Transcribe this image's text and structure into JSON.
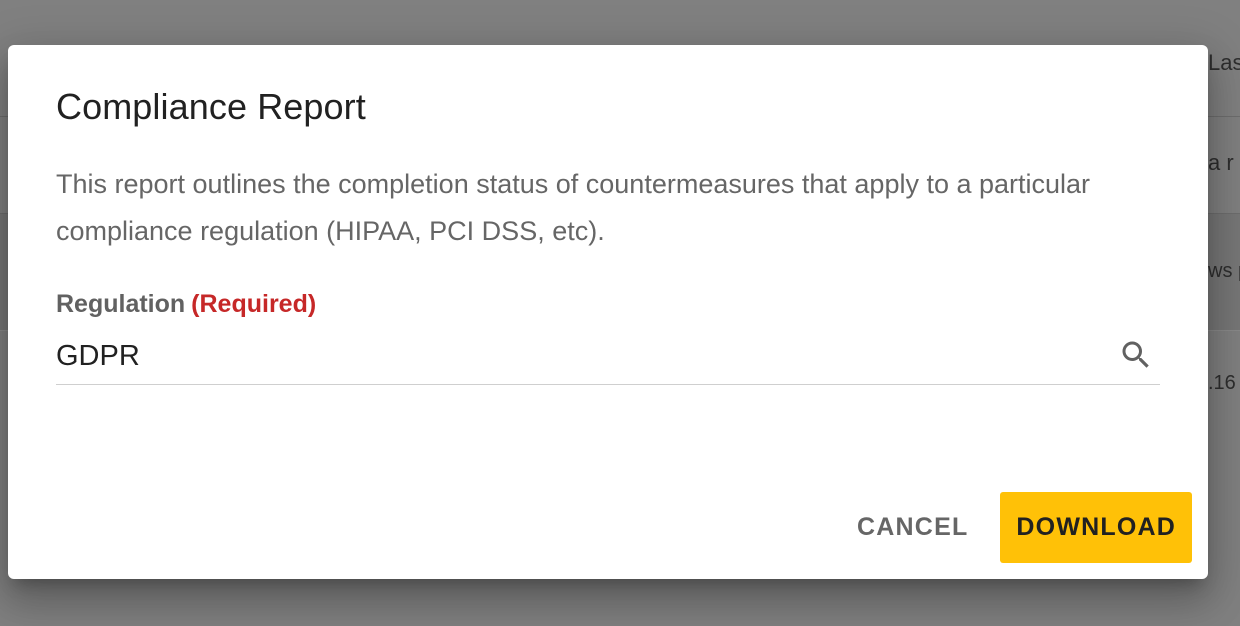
{
  "background": {
    "rows": [
      "Las",
      "a r",
      "ws p",
      ".16"
    ]
  },
  "dialog": {
    "title": "Compliance Report",
    "description": "This report outlines the completion status of countermeasures that apply to a particular compliance regulation (HIPAA, PCI DSS, etc).",
    "regulation_field": {
      "label": "Regulation",
      "required_text": "(Required)",
      "value": "GDPR",
      "icon": "search-icon"
    },
    "actions": {
      "cancel_label": "CANCEL",
      "download_label": "DOWNLOAD"
    }
  },
  "colors": {
    "primary_button": "#ffc107",
    "required": "#c62828",
    "overlay": "#808080"
  }
}
